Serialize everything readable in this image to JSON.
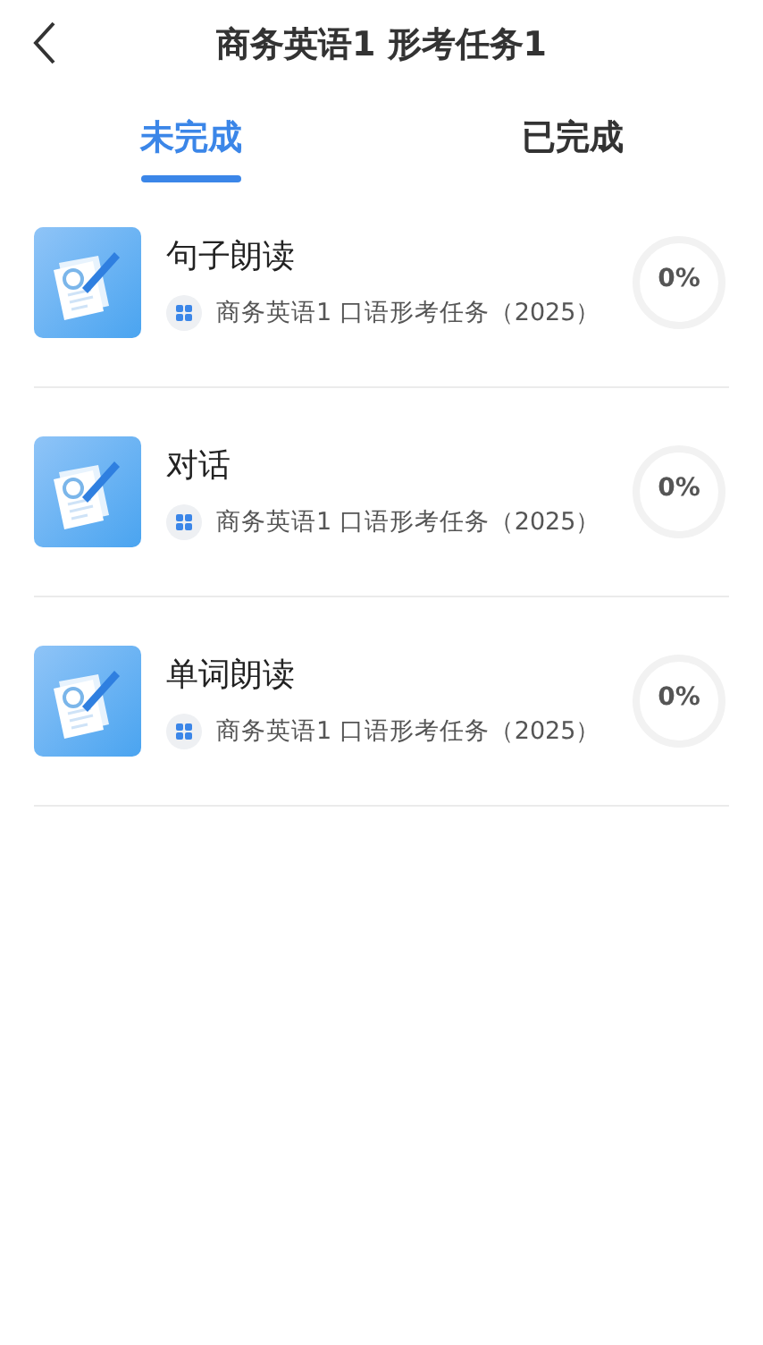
{
  "header": {
    "title": "商务英语1 形考任务1"
  },
  "tabs": [
    {
      "label": "未完成",
      "selected": true
    },
    {
      "label": "已完成",
      "selected": false
    }
  ],
  "tasks": [
    {
      "title": "句子朗读",
      "course": "商务英语1 口语形考任务（2025）",
      "percent": "0%"
    },
    {
      "title": "对话",
      "course": "商务英语1 口语形考任务（2025）",
      "percent": "0%"
    },
    {
      "title": "单词朗读",
      "course": "商务英语1 口语形考任务（2025）",
      "percent": "0%"
    }
  ]
}
